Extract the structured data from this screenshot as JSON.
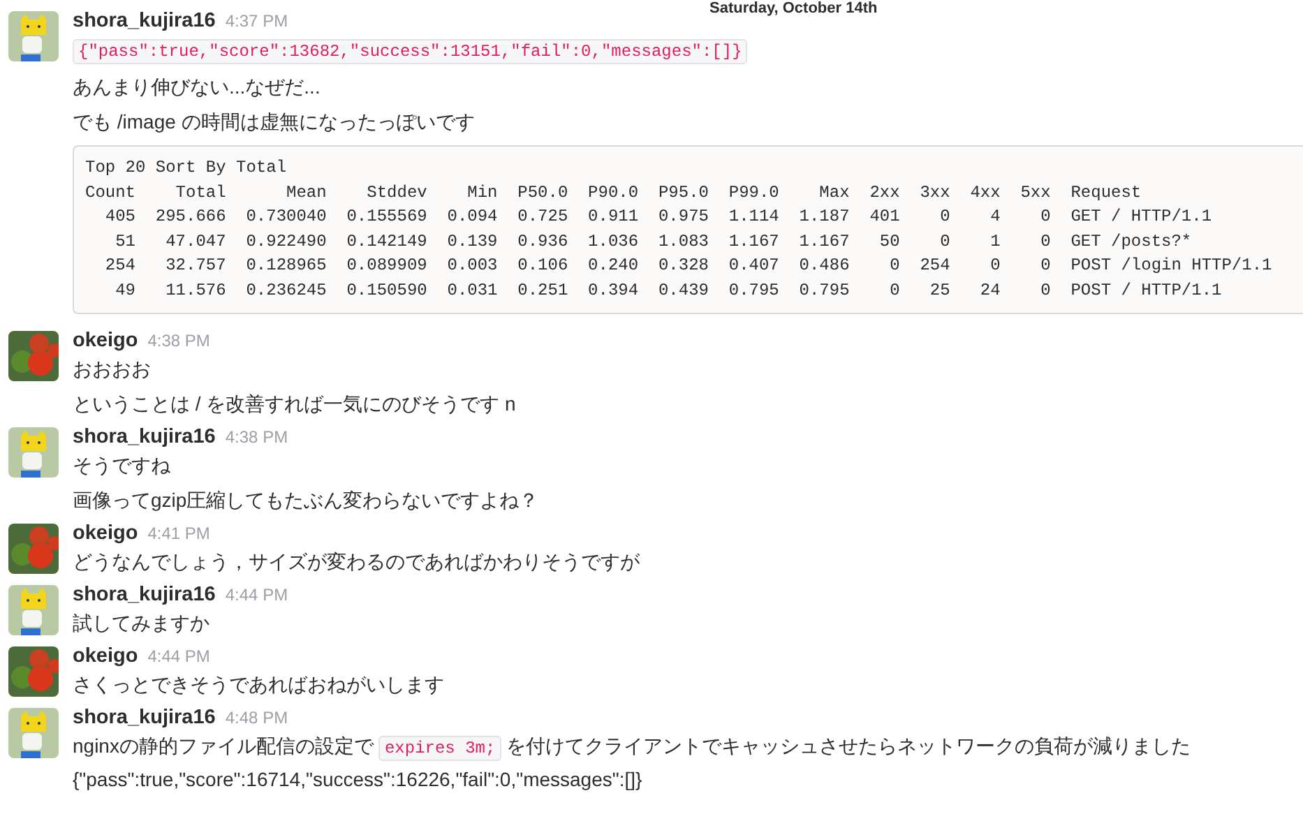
{
  "day_divider": "Saturday, October 14th",
  "messages": [
    {
      "author": "shora_kujira16",
      "time": "4:37 PM",
      "kind": "cat",
      "blocks": [
        {
          "kind": "code",
          "text": "{\"pass\":true,\"score\":13682,\"success\":13151,\"fail\":0,\"messages\":[]}"
        },
        {
          "kind": "text",
          "segments": [
            {
              "kind": "text",
              "text": "あんまり伸びない...なぜだ..."
            }
          ]
        },
        {
          "kind": "text",
          "segments": [
            {
              "kind": "text",
              "text": "でも /image の時間は虚無になったっぽいです"
            }
          ]
        },
        {
          "kind": "pre",
          "lines": [
            "Top 20 Sort By Total",
            "Count    Total      Mean    Stddev    Min  P50.0  P90.0  P95.0  P99.0    Max  2xx  3xx  4xx  5xx  Request",
            "  405  295.666  0.730040  0.155569  0.094  0.725  0.911  0.975  1.114  1.187  401    0    4    0  GET / HTTP/1.1",
            "   51   47.047  0.922490  0.142149  0.139  0.936  1.036  1.083  1.167  1.167   50    0    1    0  GET /posts?*",
            "  254   32.757  0.128965  0.089909  0.003  0.106  0.240  0.328  0.407  0.486    0  254    0    0  POST /login HTTP/1.1",
            "   49   11.576  0.236245  0.150590  0.031  0.251  0.394  0.439  0.795  0.795    0   25   24    0  POST / HTTP/1.1"
          ]
        }
      ]
    },
    {
      "author": "okeigo",
      "time": "4:38 PM",
      "kind": "tomato",
      "blocks": [
        {
          "kind": "text",
          "segments": [
            {
              "kind": "text",
              "text": "おおおお"
            }
          ]
        },
        {
          "kind": "text",
          "segments": [
            {
              "kind": "text",
              "text": "ということは / を改善すれば一気にのびそうです n"
            }
          ]
        }
      ]
    },
    {
      "author": "shora_kujira16",
      "time": "4:38 PM",
      "kind": "cat",
      "blocks": [
        {
          "kind": "text",
          "segments": [
            {
              "kind": "text",
              "text": "そうですね"
            }
          ]
        },
        {
          "kind": "text",
          "segments": [
            {
              "kind": "text",
              "text": "画像ってgzip圧縮してもたぶん変わらないですよね？"
            }
          ]
        }
      ]
    },
    {
      "author": "okeigo",
      "time": "4:41 PM",
      "kind": "tomato",
      "blocks": [
        {
          "kind": "text",
          "segments": [
            {
              "kind": "text",
              "text": "どうなんでしょう，サイズが変わるのであればかわりそうですが"
            }
          ]
        }
      ]
    },
    {
      "author": "shora_kujira16",
      "time": "4:44 PM",
      "kind": "cat",
      "blocks": [
        {
          "kind": "text",
          "segments": [
            {
              "kind": "text",
              "text": "試してみますか"
            }
          ]
        }
      ]
    },
    {
      "author": "okeigo",
      "time": "4:44 PM",
      "kind": "tomato",
      "blocks": [
        {
          "kind": "text",
          "segments": [
            {
              "kind": "text",
              "text": "さくっとできそうであればおねがいします"
            }
          ]
        }
      ]
    },
    {
      "author": "shora_kujira16",
      "time": "4:48 PM",
      "kind": "cat",
      "blocks": [
        {
          "kind": "text",
          "segments": [
            {
              "kind": "text",
              "text": "nginxの静的ファイル配信の設定で"
            },
            {
              "kind": "code",
              "text": "expires 3m;"
            },
            {
              "kind": "text",
              "text": "を付けてクライアントでキャッシュさせたらネットワークの負荷が減りました"
            }
          ]
        },
        {
          "kind": "tight",
          "segments": [
            {
              "kind": "text",
              "text": "{\"pass\":true,\"score\":16714,\"success\":16226,\"fail\":0,\"messages\":[]}"
            }
          ]
        }
      ]
    }
  ]
}
